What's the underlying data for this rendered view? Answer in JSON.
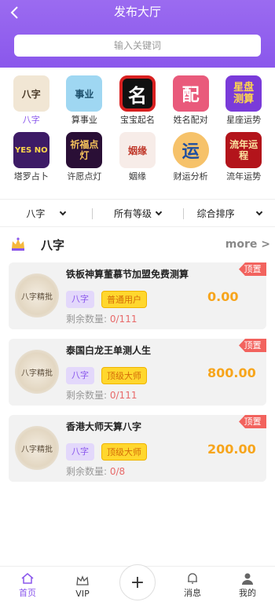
{
  "header": {
    "title": "发布大厅",
    "back_icon": "chevron-left-icon"
  },
  "search": {
    "placeholder": "输入关键词"
  },
  "categories": [
    {
      "label": "八字",
      "icon_text": "八字",
      "color": "#f1e6d4",
      "active": true
    },
    {
      "label": "算事业",
      "icon_text": "事业",
      "color": "#9fd7f2",
      "active": false
    },
    {
      "label": "宝宝起名",
      "icon_text": "名",
      "color": "#111111",
      "active": false
    },
    {
      "label": "姓名配对",
      "icon_text": "配",
      "color": "#e95a7b",
      "active": false
    },
    {
      "label": "星座运势",
      "icon_text": "星盘测算",
      "color": "#7a3bd9",
      "active": false
    },
    {
      "label": "塔罗占卜",
      "icon_text": "YES NO",
      "color": "#3d1b66",
      "active": false
    },
    {
      "label": "许愿点灯",
      "icon_text": "祈福点灯",
      "color": "#2a0f36",
      "active": false
    },
    {
      "label": "姻缘",
      "icon_text": "姻缘",
      "color": "#f7ece8",
      "active": false
    },
    {
      "label": "财运分析",
      "icon_text": "运",
      "color": "#f6c26a",
      "active": false
    },
    {
      "label": "流年运势",
      "icon_text": "流年运程",
      "color": "#b3141b",
      "active": false
    }
  ],
  "filters": [
    {
      "label": "八字"
    },
    {
      "label": "所有等级"
    },
    {
      "label": "综合排序"
    }
  ],
  "section": {
    "title": "八字",
    "more": "more >"
  },
  "cards": [
    {
      "title": "铁板神算董慕节加盟免费测算",
      "category": "八字",
      "level": "普通用户",
      "remain_label": "剩余数量:",
      "remain": "0/111",
      "price": "0.00",
      "pin": "顶置",
      "avatar_text": "八字精批"
    },
    {
      "title": "泰国白龙王单测人生",
      "category": "八字",
      "level": "顶级大师",
      "remain_label": "剩余数量:",
      "remain": "0/111",
      "price": "800.00",
      "pin": "顶置",
      "avatar_text": "八字精批"
    },
    {
      "title": "香港大师天算八字",
      "category": "八字",
      "level": "顶级大师",
      "remain_label": "剩余数量:",
      "remain": "0/8",
      "price": "200.00",
      "pin": "顶置",
      "avatar_text": "八字精批"
    }
  ],
  "tabbar": [
    {
      "label": "首页",
      "icon": "home-icon",
      "active": true
    },
    {
      "label": "VIP",
      "icon": "crown-icon",
      "active": false
    },
    {
      "label": "",
      "icon": "plus-icon",
      "active": false
    },
    {
      "label": "消息",
      "icon": "bell-icon",
      "active": false
    },
    {
      "label": "我的",
      "icon": "user-icon",
      "active": false
    }
  ],
  "colors": {
    "accent": "#8a57ec",
    "price": "#f7a51c",
    "pin": "#f2635e",
    "level_bg": "#ffd72e"
  }
}
